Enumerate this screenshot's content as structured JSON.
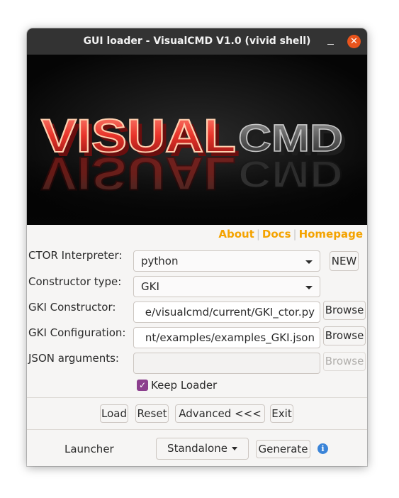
{
  "window": {
    "title": "GUI loader - VisualCMD V1.0 (vivid shell)",
    "close_glyph": "✕"
  },
  "banner": {
    "logo_word1": "VISUAL",
    "logo_word2": "CMD"
  },
  "links": {
    "about": "About",
    "docs": "Docs",
    "homepage": "Homepage",
    "color": "#f4a300"
  },
  "form": {
    "ctor_interpreter": {
      "label": "CTOR Interpreter:",
      "value": "python",
      "new_button": "NEW"
    },
    "constructor_type": {
      "label": "Constructor type:",
      "value": "GKI"
    },
    "gki_constructor": {
      "label": "GKI Constructor:",
      "value": "e/visualcmd/current/GKI_ctor.py",
      "browse": "Browse"
    },
    "gki_configuration": {
      "label": "GKI Configuration:",
      "value": "nt/examples/examples_GKI.json",
      "browse": "Browse"
    },
    "json_arguments": {
      "label": "JSON arguments:",
      "value": "",
      "browse": "Browse"
    },
    "keep_loader": {
      "label": "Keep Loader",
      "checked": true
    }
  },
  "actions": {
    "load": "Load",
    "reset": "Reset",
    "advanced": "Advanced <<<",
    "exit": "Exit"
  },
  "launcher": {
    "label": "Launcher",
    "mode": "Standalone",
    "generate": "Generate",
    "info_glyph": "i"
  },
  "colors": {
    "titlebar": "#333333",
    "close": "#e9541c",
    "checkbox": "#8c3f8e",
    "info": "#3a84d8"
  }
}
